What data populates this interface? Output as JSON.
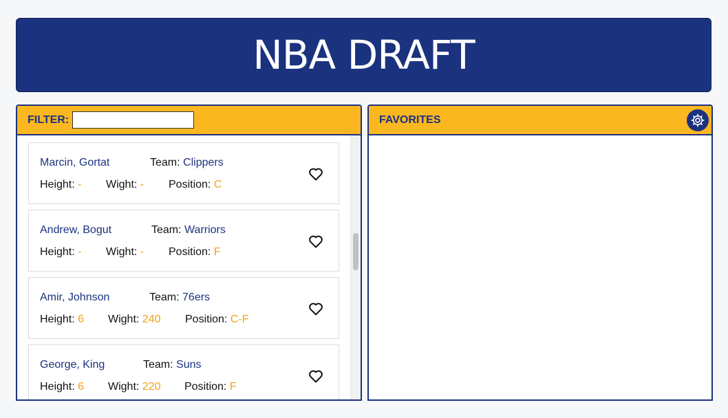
{
  "header": {
    "title": "NBA DRAFT"
  },
  "filter": {
    "label": "FILTER:",
    "value": ""
  },
  "favorites": {
    "label": "FAVORITES"
  },
  "labels": {
    "team": "Team:",
    "height": "Height:",
    "weight": "Wight:",
    "position": "Position:"
  },
  "icons": {
    "settings": "gear-icon",
    "favorite": "heart-outline-icon"
  },
  "colors": {
    "navy": "#1b327e",
    "gold": "#fbb71f",
    "value_orange": "#f3a01a"
  },
  "players": [
    {
      "name": "Marcin, Gortat",
      "team": "Clippers",
      "height": "-",
      "weight": "-",
      "position": "C"
    },
    {
      "name": "Andrew, Bogut",
      "team": "Warriors",
      "height": "-",
      "weight": "-",
      "position": "F"
    },
    {
      "name": "Amir, Johnson",
      "team": "76ers",
      "height": "6",
      "weight": "240",
      "position": "C-F"
    },
    {
      "name": "George, King",
      "team": "Suns",
      "height": "6",
      "weight": "220",
      "position": "F"
    }
  ]
}
